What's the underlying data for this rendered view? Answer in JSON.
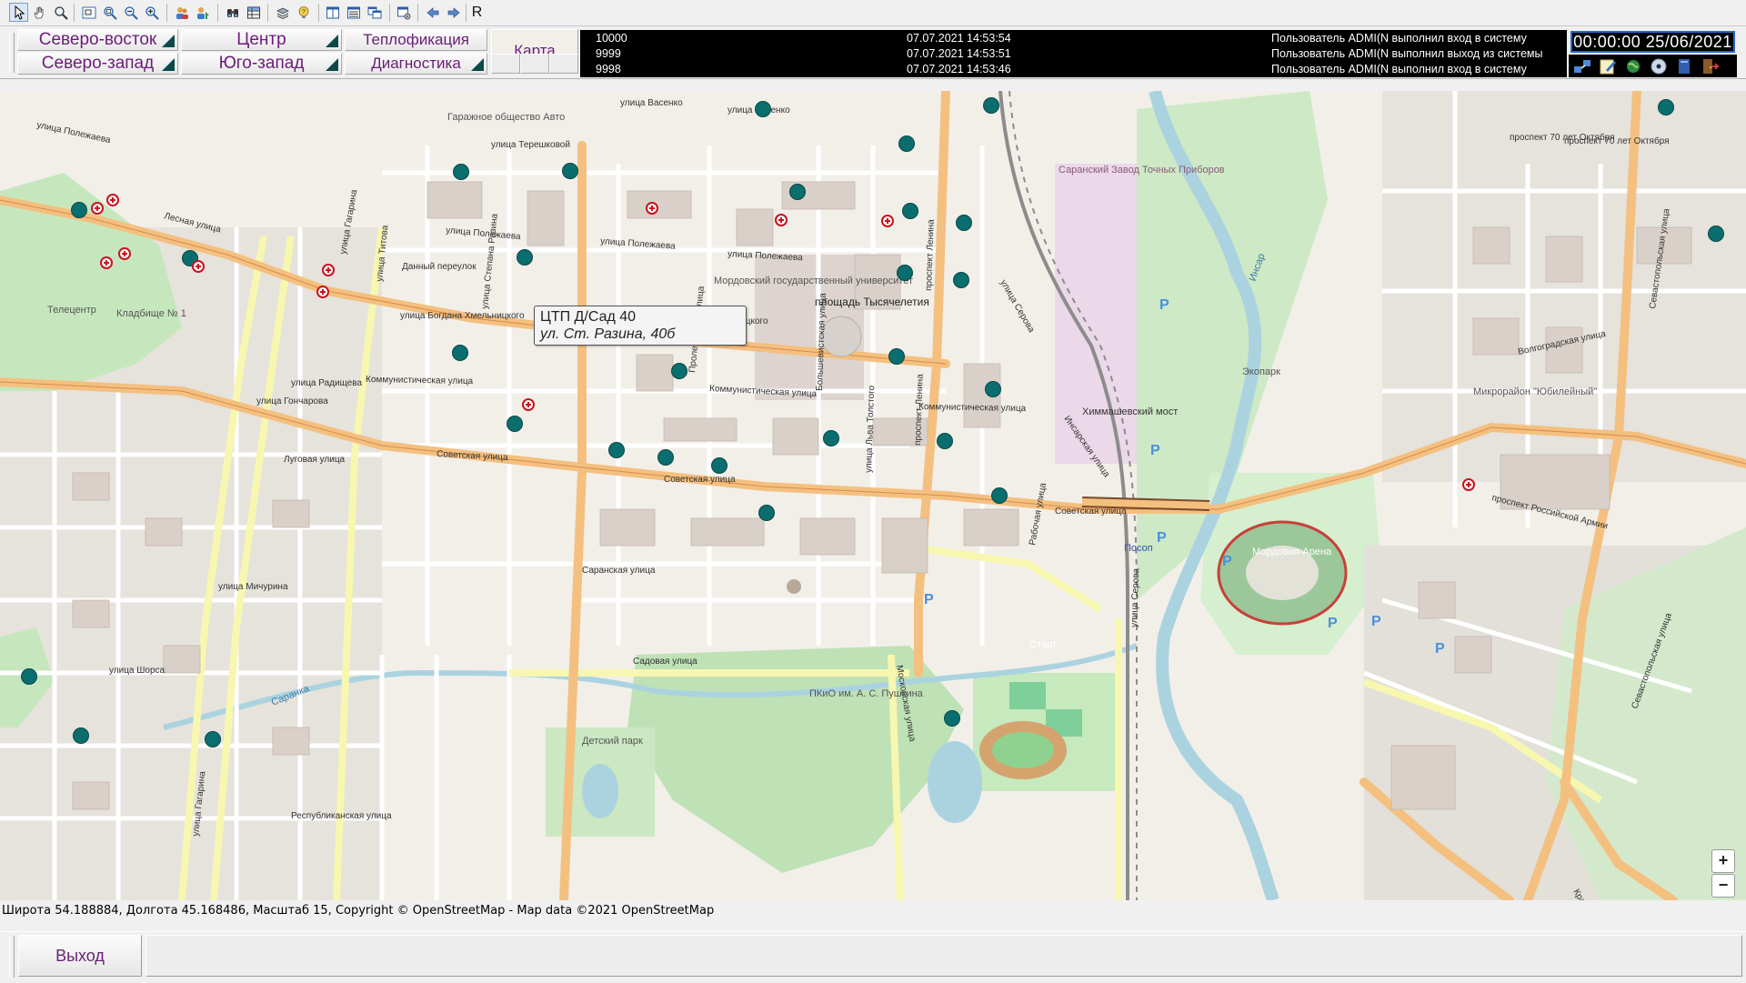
{
  "toolbar": {
    "icons": [
      "select-arrow-icon",
      "hand-pan-icon",
      "magnifier-icon",
      "zoom-window-icon",
      "zoom-fit-icon",
      "zoom-out-icon",
      "zoom-in-icon",
      "user-group-icon",
      "user-pin-icon",
      "binoculars-icon",
      "table-icon",
      "layers-icon",
      "bulb-help-icon",
      "window-split-icon",
      "list-icon",
      "windows-icon",
      "window-settings-icon",
      "arrow-back-icon",
      "arrow-forward-icon"
    ],
    "r_label": "R"
  },
  "nav": {
    "row1": [
      "Северо-восток",
      "Центр",
      "Теплофикация"
    ],
    "row2": [
      "Северо-запад",
      "Юго-запад",
      "Диагностика"
    ],
    "map_label": "Карта"
  },
  "log": {
    "rows": [
      {
        "id": "10000",
        "time": "07.07.2021 14:53:54",
        "msg": "Пользователь ADMI(N выполнил вход в систему"
      },
      {
        "id": "9999",
        "time": "07.07.2021 14:53:51",
        "msg": "Пользователь ADMI(N выполнил выход из системы"
      },
      {
        "id": "9998",
        "time": "07.07.2021 14:53:46",
        "msg": "Пользователь ADMI(N выполнил вход в систему"
      }
    ]
  },
  "clock": "00:00:00  25/06/2021",
  "sys_icons": [
    "network-arrows-icon",
    "notepad-edit-icon",
    "globe-icon",
    "disk-icon",
    "book-icon",
    "exit-door-icon"
  ],
  "map": {
    "street_labels": [
      "улица Васенко",
      "улица Полежаева",
      "улица Терешковой",
      "улица Титова",
      "улица Гагарина",
      "проспект Ленина",
      "улица Серова",
      "Коммунистическая улица",
      "Советская улица",
      "Химмашевский мост",
      "Волгоградская улица",
      "Севастопольская улица",
      "проспект 70 лет Октября",
      "улица Богдана Хмельницкого",
      "улица Степана Разина",
      "Пролетарская улица",
      "Большевистская улица",
      "улица Льва Толстого",
      "Рабочая улица",
      "Саранская улица",
      "Московская улица",
      "Республиканская улица",
      "Инсарская улица",
      "Садовая улица",
      "улица Шорса",
      "улица Мичурина",
      "проспект Российской Армии",
      "Красная улица",
      "Лесная улица",
      "Данный переулок",
      "улица Гончарова",
      "улица Радищева",
      "Луговая улица"
    ],
    "area_labels": [
      "Мордовский государственный университет",
      "площадь Тысячелетия",
      "Саранский Завод Точных Приборов",
      "Мордовия-Арена",
      "Микрорайон \"Юбилейный\"",
      "ПКиО им. А. С. Пушкина",
      "Старт",
      "Детский парк",
      "Кладбище № 1",
      "Телецентр",
      "Экопарк",
      "Инсар",
      "Саранка",
      "Гаражное общество Авто",
      "Посоп"
    ],
    "tooltip": {
      "title": "ЦТП Д/Сад 40",
      "address": "ул. Ст. Разина, 40б"
    },
    "zoom_in": "+",
    "zoom_out": "−"
  },
  "status_line": "Широта 54.188884, Долгота 45.168486, Масштаб 15, Copyright © OpenStreetMap - Map data ©2021 OpenStreetMap",
  "footer": {
    "exit_label": "Выход"
  },
  "colors": {
    "nav_text": "#6b1d78",
    "marker": "#0a6e6e",
    "road_major": "#f7c58b",
    "road_secondary": "#f7f7b0",
    "park": "#c8e8c0",
    "water": "#aad3df",
    "clock_border": "#2a68c8"
  }
}
